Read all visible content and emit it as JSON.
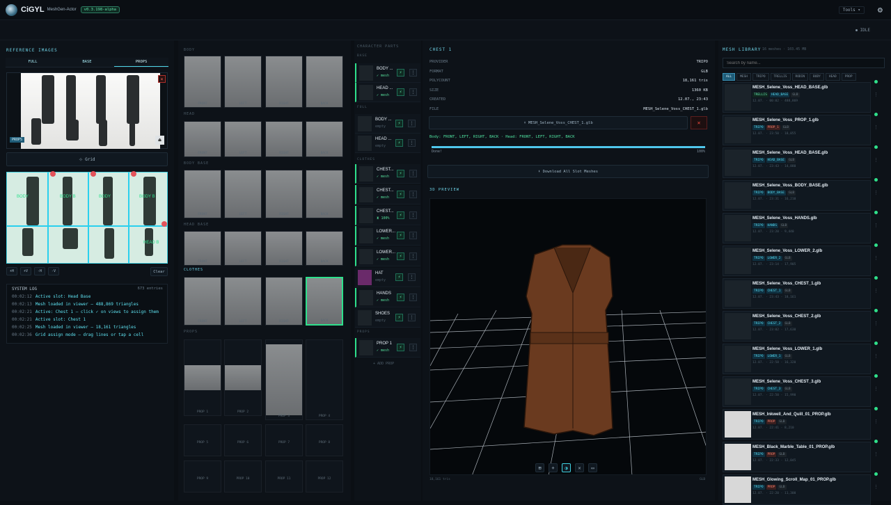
{
  "app": {
    "brand": "CiGYL",
    "subtitle": "MeshGen-Actor",
    "version": "v0.3.198-alpha",
    "tools": "Tools ▾",
    "status": "IDLE"
  },
  "left": {
    "title": "REFERENCE IMAGES",
    "tabs": [
      "FULL",
      "BASE",
      "PROPS"
    ],
    "props_badge": "PROPS",
    "grid_label": "⊹ Grid",
    "controls": [
      "+H",
      "+V",
      "-H",
      "-V"
    ],
    "clear": "Clear",
    "grid_labels": [
      "BODY",
      "BODY B",
      "BODY",
      "BODY B",
      "HEAD B"
    ]
  },
  "log": {
    "title": "SYSTEM LOG",
    "count": "673 entries",
    "lines": [
      {
        "t": "00:02:12",
        "m": "Active slot: Head Base"
      },
      {
        "t": "00:02:13",
        "m": "Mesh loaded in viewer — 488,869 triangles"
      },
      {
        "t": "00:02:21",
        "m": "Active: Chest 1 — click ✓ on views to assign them"
      },
      {
        "t": "00:02:21",
        "m": "Active slot: Chest 1"
      },
      {
        "t": "00:02:25",
        "m": "Mesh loaded in viewer — 18,161 triangles"
      },
      {
        "t": "00:02:36",
        "m": "Grid assign mode — drag lines or tap a cell"
      }
    ]
  },
  "mid": {
    "body": "BODY",
    "head": "HEAD",
    "body_base": "BODY BASE",
    "head_base": "HEAD BASE",
    "clothes": "CLOTHES",
    "props": "PROPS",
    "view_labels": [
      "FRONT",
      "LEFT",
      "RIGHT",
      "BACK"
    ],
    "prop_slots": [
      "PROP 1",
      "PROP 2",
      "PROP 3",
      "PROP 4",
      "PROP 5",
      "PROP 6",
      "PROP 7",
      "PROP 8",
      "PROP 9",
      "PROP 10",
      "PROP 11",
      "PROP 12"
    ]
  },
  "parts": {
    "title": "CHARACTER PARTS",
    "base": "BASE",
    "full": "FULL",
    "clothes": "CLOTHES",
    "props": "PROPS",
    "add": "+ ADD PROP",
    "slots": [
      {
        "name": "BODY ...",
        "st": "✓ mesh"
      },
      {
        "name": "HEAD ...",
        "st": "✓ mesh"
      },
      {
        "name": "BODY ...",
        "st": "empty"
      },
      {
        "name": "HEAD ...",
        "st": "empty"
      },
      {
        "name": "CHEST...",
        "st": "✓ mesh"
      },
      {
        "name": "CHEST...",
        "st": "✓ mesh"
      },
      {
        "name": "CHEST...",
        "st": "⧗ 100%"
      },
      {
        "name": "LOWER...",
        "st": "✓ mesh"
      },
      {
        "name": "LOWER...",
        "st": "✓ mesh"
      },
      {
        "name": "HAT",
        "st": "empty"
      },
      {
        "name": "HANDS",
        "st": "✓ mesh"
      },
      {
        "name": "SHOES",
        "st": "empty"
      },
      {
        "name": "PROP 1",
        "st": "✓ mesh"
      }
    ]
  },
  "detail": {
    "title": "CHEST 1",
    "rows": [
      {
        "k": "PROVIDER",
        "v": "TRIPO"
      },
      {
        "k": "FORMAT",
        "v": "GLB"
      },
      {
        "k": "POLYCOUNT",
        "v": "18,161 tris"
      },
      {
        "k": "SIZE",
        "v": "1360 KB"
      },
      {
        "k": "CREATED",
        "v": "12.07., 23:43"
      },
      {
        "k": "FILE",
        "v": "MESH_Selene_Voss_CHEST_1.glb"
      }
    ],
    "file_btn": "⬇ MESH_Selene_Voss_CHEST_1.glb",
    "views": "Body: FRONT, LEFT, RIGHT, BACK · Head: FRONT, LEFT, RIGHT, BACK",
    "done": "Done!",
    "pct": "100%",
    "progress": 1.0,
    "download_all": "⬇ Download All Slot Meshes",
    "preview": "3D PREVIEW",
    "tri": "18,161 tris",
    "fmt": "GLB"
  },
  "lib": {
    "title": "MESH LIBRARY",
    "count": "16 meshes · 103.45 MB",
    "search": "Search by name...",
    "filters": [
      "ALL",
      "MESH",
      "TRIPO",
      "TRELLIS",
      "RODIN",
      "BODY",
      "HEAD",
      "PROP"
    ],
    "items": [
      {
        "name": "MESH_Selene_Voss_HEAD_BASE.glb",
        "t1": "TRELLIS",
        "t2": "HEAD_BASE",
        "t3": "GLB",
        "meta": "12.07. · 00:02 · 488,869"
      },
      {
        "name": "MESH_Selene_Voss_PROP_1.glb",
        "t1": "TRIPO",
        "t2": "PROP_1",
        "t3": "GLB",
        "meta": "12.07. · 23:50 · 18,055"
      },
      {
        "name": "MESH_Selene_Voss_HEAD_BASE.glb",
        "t1": "TRIPO",
        "t2": "HEAD_BASE",
        "t3": "GLB",
        "meta": "12.07. · 23:43 · 14,880"
      },
      {
        "name": "MESH_Selene_Voss_BODY_BASE.glb",
        "t1": "TRIPO",
        "t2": "BODY_BASE",
        "t3": "GLB",
        "meta": "12.07. · 23:31 · 16,210"
      },
      {
        "name": "MESH_Selene_Voss_HANDS.glb",
        "t1": "TRIPO",
        "t2": "HANDS",
        "t3": "GLB",
        "meta": "12.07. · 23:20 · 9,440"
      },
      {
        "name": "MESH_Selene_Voss_LOWER_2.glb",
        "t1": "TRIPO",
        "t2": "LOWER_2",
        "t3": "GLB",
        "meta": "12.07. · 23:14 · 17,905"
      },
      {
        "name": "MESH_Selene_Voss_CHEST_1.glb",
        "t1": "TRIPO",
        "t2": "CHEST_1",
        "t3": "GLB",
        "meta": "12.07. · 23:43 · 18,161"
      },
      {
        "name": "MESH_Selene_Voss_CHEST_2.glb",
        "t1": "TRIPO",
        "t2": "CHEST_2",
        "t3": "GLB",
        "meta": "12.07. · 23:02 · 17,630"
      },
      {
        "name": "MESH_Selene_Voss_LOWER_1.glb",
        "t1": "TRIPO",
        "t2": "LOWER_1",
        "t3": "GLB",
        "meta": "12.07. · 22:58 · 16,320"
      },
      {
        "name": "MESH_Selene_Voss_CHEST_3.glb",
        "t1": "TRIPO",
        "t2": "CHEST_3",
        "t3": "GLB",
        "meta": "12.07. · 22:50 · 15,990"
      },
      {
        "name": "MESH_Inkwell_And_Quill_01_PROP.glb",
        "t1": "TRIPO",
        "t2": "PROP",
        "t3": "GLB",
        "meta": "12.07. · 22:41 · 8,210"
      },
      {
        "name": "MESH_Black_Marble_Table_01_PROP.glb",
        "t1": "TRIPO",
        "t2": "PROP",
        "t3": "GLB",
        "meta": "12.07. · 22:33 · 12,045"
      },
      {
        "name": "MESH_Glowing_Scroll_Map_01_PROP.glb",
        "t1": "TRIPO",
        "t2": "PROP",
        "t3": "GLB",
        "meta": "12.07. · 22:20 · 11,300"
      }
    ]
  }
}
